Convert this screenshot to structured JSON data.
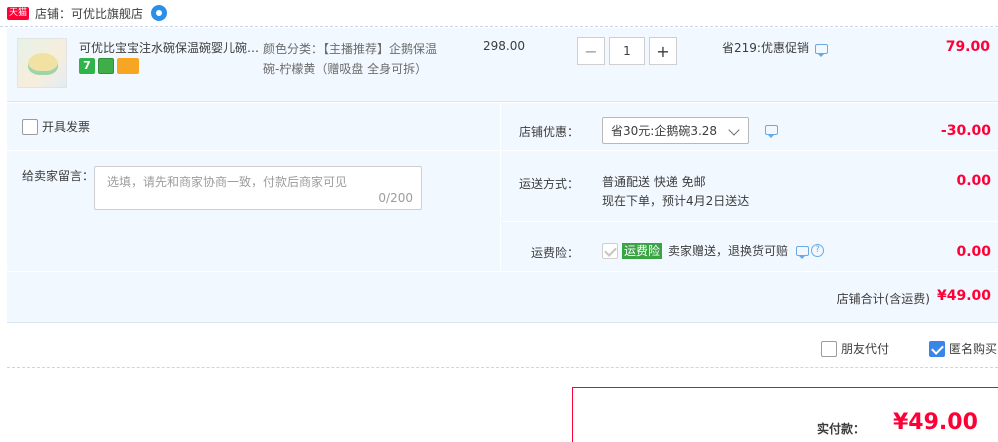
{
  "shop": {
    "badge": "天猫",
    "label": "店铺：",
    "name": "可优比旗舰店"
  },
  "item": {
    "title": "可优比宝宝注水碗保温碗婴儿碗…",
    "tag_text": "7",
    "sku_line1": "颜色分类：【主播推荐】企鹅保温",
    "sku_line2": "碗-柠檬黄（赠吸盘 全身可拆）",
    "price": "298.00",
    "qty_minus": "−",
    "qty_value": "1",
    "qty_plus": "+",
    "promo": "省219:优惠促销",
    "row_total": "79.00"
  },
  "options": {
    "invoice_label": "开具发票",
    "note_label": "给卖家留言：",
    "note_placeholder": "选填，请先和商家协商一致，付款后商家可见",
    "note_count": "0/200",
    "coupon_label": "店铺优惠：",
    "coupon_value": "省30元:企鹅碗3.28",
    "coupon_amount": "-30.00",
    "shipping_label": "运送方式：",
    "shipping_line1": "普通配送 快递 免邮",
    "shipping_line2": "现在下单，预计4月2日送达",
    "shipping_amount": "0.00",
    "insurance_label": "运费险：",
    "insurance_tag": "运费险",
    "insurance_text": "卖家赠送，退换货可赔",
    "insurance_amount": "0.00",
    "subtotal_label": "店铺合计(含运费)",
    "subtotal_value": "¥49.00"
  },
  "extra": {
    "friend_pay": "朋友代付",
    "anonymous": "匿名购买"
  },
  "pay": {
    "label": "实付款：",
    "amount": "¥49.00"
  },
  "colors": {
    "accent_red": "#ff0036",
    "panel_bg": "#f2f8ff",
    "check_blue": "#3a86e8",
    "insurance_green": "#3aa343"
  }
}
